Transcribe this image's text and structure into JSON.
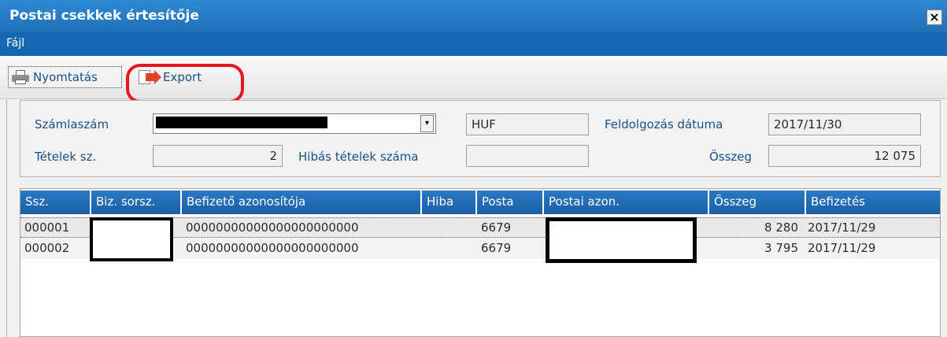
{
  "window": {
    "title": "Postai csekkek értesítője",
    "close_glyph": "×"
  },
  "menu": {
    "file": "Fájl"
  },
  "toolbar": {
    "print_label": "Nyomtatás",
    "export_label": "Export",
    "print_icon": "printer-icon",
    "export_icon": "export-icon"
  },
  "form": {
    "account_label": "Számlaszám",
    "account_value": "",
    "currency": "HUF",
    "processing_date_label": "Feldolgozás dátuma",
    "processing_date": "2017/11/30",
    "items_count_label": "Tételek sz.",
    "items_count": "2",
    "error_items_label": "Hibás tételek száma",
    "error_items": "",
    "total_label": "Összeg",
    "total": "12 075"
  },
  "table": {
    "headers": [
      "Ssz.",
      "Biz. sorsz.",
      "Befizető azonosítója",
      "Hiba",
      "Posta",
      "Postai azon.",
      "Összeg",
      "Befizetés"
    ],
    "rows": [
      {
        "ssz": "000001",
        "biz": "",
        "befizeto": "00000000000000000000000",
        "hiba": "",
        "posta": "6679",
        "postai": "",
        "osszeg": "8 280",
        "befizetes": "2017/11/29"
      },
      {
        "ssz": "000002",
        "biz": "",
        "befizeto": "00000000000000000000000",
        "hiba": "",
        "posta": "6679",
        "postai": "",
        "osszeg": "3 795",
        "befizetes": "2017/11/29"
      }
    ]
  },
  "colors": {
    "title_bar": "#1f70b8",
    "menu_bar": "#1468b2",
    "highlight": "#e8161c",
    "label_text": "#1a4f86"
  }
}
